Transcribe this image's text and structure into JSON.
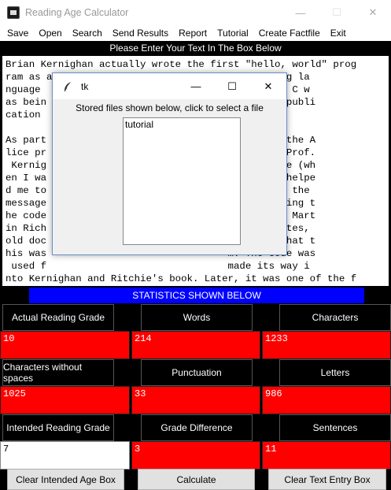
{
  "window": {
    "title": "Reading Age Calculator",
    "minimize": "—",
    "maximize": "☐",
    "close": "✕"
  },
  "menu": [
    "Save",
    "Open",
    "Search",
    "Send Results",
    "Report",
    "Tutorial",
    "Create Factfile",
    "Exit"
  ],
  "header": "Please Enter Your Text In The Box Below",
  "text_lines": [
    "Brian Kernighan actually wrote the first \"hello, world\" prog",
    "ram as a                              programming la",
    "nguage                                used while C w",
    "as bein                               efore the publi",
    "cation                                972.",
    "",
    "As part                               ing about the A",
    "lice pr                               with both Prof.",
    " Kernig                               t Cambridge (wh",
    "en I wa                               's). They helpe",
    "d me to                               e to print the",
    "message                               bered writing t",
    "he code                               PL manual. Mart",
    "in Rich                               rove of notes,",
    "old doc                               onfirmed that t",
    "his was                               m. The code was",
    " used f                               made its way i",
    "nto Kernighan and Ritchie's book. Later, it was one of the f"
  ],
  "stats_banner": "STATISTICS SHOWN BELOW",
  "stats": {
    "actual_reading_grade": {
      "label": "Actual Reading Grade",
      "value": "10"
    },
    "words": {
      "label": "Words",
      "value": "214"
    },
    "characters": {
      "label": "Characters",
      "value": "1233"
    },
    "characters_no_spaces": {
      "label": "Characters without spaces",
      "value": "1025"
    },
    "punctuation": {
      "label": "Punctuation",
      "value": "33"
    },
    "letters": {
      "label": "Letters",
      "value": "986"
    },
    "intended_reading_grade": {
      "label": "Intended Reading Grade",
      "value": "7"
    },
    "grade_difference": {
      "label": "Grade Difference",
      "value": "3"
    },
    "sentences": {
      "label": "Sentences",
      "value": "11"
    }
  },
  "buttons": {
    "clear_age": "Clear Intended Age Box",
    "calculate": "Calculate",
    "clear_text": "Clear Text Entry Box"
  },
  "dialog": {
    "title": "tk",
    "message": "Stored files shown below, click to select a file",
    "files": [
      "tutorial"
    ],
    "minimize": "—",
    "maximize": "☐",
    "close": "✕"
  },
  "colors": {
    "stat_value_bg": "#ff0000",
    "stats_banner_bg": "#0000ff"
  }
}
